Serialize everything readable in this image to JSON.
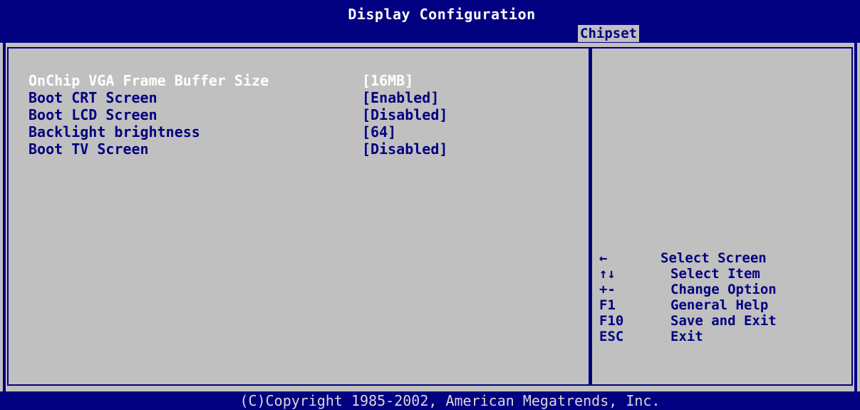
{
  "header": {
    "title": "Display Configuration",
    "active_tab": "Chipset"
  },
  "settings": [
    {
      "label": "OnChip VGA Frame Buffer Size",
      "value": "[16MB]",
      "selected": true
    },
    {
      "label": "Boot CRT Screen",
      "value": "[Enabled]",
      "selected": false
    },
    {
      "label": "Boot LCD Screen",
      "value": "[Disabled]",
      "selected": false
    },
    {
      "label": "Backlight brightness",
      "value": "[64]",
      "selected": false
    },
    {
      "label": "Boot TV Screen",
      "value": "[Disabled]",
      "selected": false
    }
  ],
  "help": [
    {
      "key": "←",
      "action": "Select Screen"
    },
    {
      "key": "↑↓",
      "action": "Select Item"
    },
    {
      "key": "+-",
      "action": "Change Option"
    },
    {
      "key": "F1",
      "action": "General Help"
    },
    {
      "key": "F10",
      "action": "Save and Exit"
    },
    {
      "key": "ESC",
      "action": "Exit"
    }
  ],
  "footer": {
    "copyright": "(C)Copyright 1985-2002, American Megatrends, Inc."
  },
  "colors": {
    "background": "#c0c0c0",
    "bar": "#000080",
    "selected_text": "#ffffff"
  }
}
